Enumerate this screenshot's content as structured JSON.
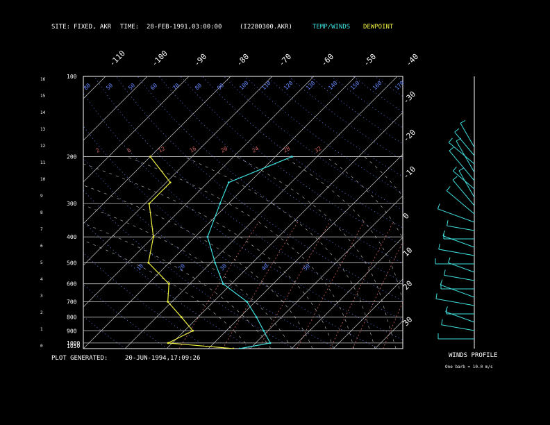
{
  "header": {
    "site_label": "SITE:",
    "site_value": "FIXED, AKR",
    "time_label": "TIME:",
    "time_value": "28-FEB-1991,03:00:00",
    "file_id": "(I2280300.AKR)",
    "legend_temp": "TEMP/WINDS",
    "legend_dew": "DEWPOINT"
  },
  "footer": {
    "generated_label": "PLOT GENERATED:",
    "generated_value": "20-JUN-1994,17:09:26"
  },
  "winds_panel": {
    "title": "WINDS PROFILE",
    "note": "One barb = 10.0 m/s"
  },
  "colors": {
    "temp": "#40e0e0",
    "dew": "#f0f040",
    "text": "#ffffff",
    "isotherm": "#c8c8c8",
    "isobar": "#c8c8c8",
    "dry_adiabat": "#6688ff",
    "mixing_ratio": "#d06060",
    "moist_adiabat": "#aaaaaa"
  },
  "chart_data": {
    "type": "line",
    "left_axis_km": [
      "0",
      "1",
      "2",
      "3",
      "4",
      "5",
      "6",
      "7",
      "8",
      "9",
      "10",
      "11",
      "12",
      "13",
      "14",
      "15",
      "16"
    ],
    "pressure_labels": [
      "100",
      "200",
      "300",
      "400",
      "500",
      "600",
      "700",
      "800",
      "900",
      "1000",
      "1050"
    ],
    "top_temp_labels": [
      "-110",
      "-100",
      "-90",
      "-80",
      "-70",
      "-60",
      "-50",
      "-40"
    ],
    "right_temp_labels": [
      "-30",
      "-20",
      "-10",
      "0",
      "10",
      "20",
      "30"
    ],
    "theta_labels": [
      "80",
      "50",
      "50",
      "60",
      "70",
      "80",
      "90",
      "100",
      "110",
      "120",
      "130",
      "140",
      "150",
      "160",
      "170",
      "10",
      "20",
      "30",
      "40",
      "50"
    ],
    "mixing_labels": [
      "2",
      "6",
      "12",
      "16",
      "20",
      "24",
      "28",
      "32"
    ],
    "series": [
      {
        "name": "TEMP/WINDS",
        "points": [
          [
            1050,
            -12.5
          ],
          [
            1000,
            -6.5
          ],
          [
            900,
            -11
          ],
          [
            800,
            -16
          ],
          [
            700,
            -22
          ],
          [
            600,
            -32
          ],
          [
            500,
            -39
          ],
          [
            400,
            -47
          ],
          [
            300,
            -52
          ],
          [
            250,
            -55
          ],
          [
            200,
            -46
          ]
        ]
      },
      {
        "name": "DEWPOINT",
        "points": [
          [
            1050,
            -14
          ],
          [
            1000,
            -31
          ],
          [
            900,
            -28
          ],
          [
            800,
            -34
          ],
          [
            700,
            -41
          ],
          [
            600,
            -45
          ],
          [
            500,
            -55
          ],
          [
            400,
            -60
          ],
          [
            300,
            -69
          ],
          [
            250,
            -69
          ],
          [
            200,
            -80
          ]
        ]
      }
    ]
  }
}
